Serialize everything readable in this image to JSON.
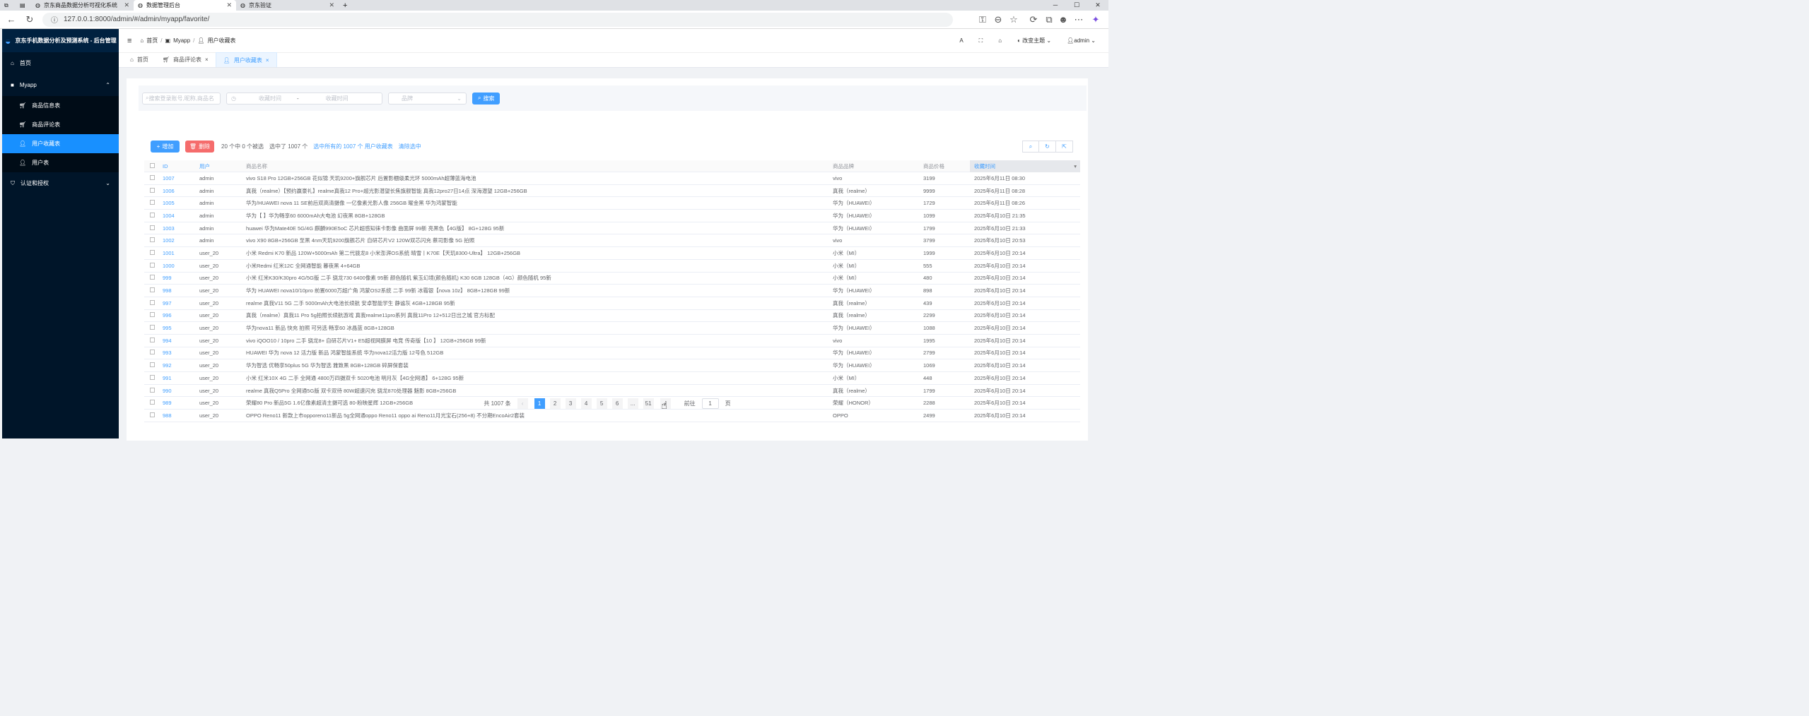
{
  "browser": {
    "tabs": [
      {
        "title": "京东商品数据分析可视化系统",
        "active": false
      },
      {
        "title": "数据管理后台",
        "active": true
      },
      {
        "title": "京东验证",
        "active": false
      }
    ],
    "url": "127.0.0.1:8000/admin/#/admin/myapp/favorite/"
  },
  "sidebar": {
    "brand": "京东手机数据分析及预测系统 - 后台管理",
    "items": [
      {
        "label": "首页",
        "icon": "home-icon",
        "level": 0
      },
      {
        "label": "Myapp",
        "icon": "square-icon",
        "level": 0,
        "expanded": true
      },
      {
        "label": "商品信息表",
        "icon": "cart-icon",
        "level": 1
      },
      {
        "label": "商品评论表",
        "icon": "cart-icon",
        "level": 1
      },
      {
        "label": "用户收藏表",
        "icon": "user-icon",
        "level": 1,
        "active": true
      },
      {
        "label": "用户表",
        "icon": "user-icon",
        "level": 1
      },
      {
        "label": "认证和授权",
        "icon": "shield-icon",
        "level": 0,
        "collapsible": true
      }
    ]
  },
  "header": {
    "breadcrumb": [
      "首页",
      "Myapp",
      "用户收藏表"
    ],
    "theme_label": "改变主题",
    "user_label": "admin"
  },
  "tabs": [
    {
      "label": "首页",
      "icon": "home-icon"
    },
    {
      "label": "商品评论表",
      "icon": "cart-icon",
      "closable": true
    },
    {
      "label": "用户收藏表",
      "icon": "user-icon",
      "closable": true,
      "active": true
    }
  ],
  "filters": {
    "search_placeholder": "搜索登录账号,昵称,商品名",
    "date_start_placeholder": "收藏时间",
    "date_sep": "-",
    "date_end_placeholder": "收藏时间",
    "brand_placeholder": "品牌",
    "search_button": "搜索"
  },
  "actions": {
    "add_label": "增加",
    "delete_label": "删除",
    "selection_text": "20 个中 0 个被选",
    "selected_count_text": "选中了 1007 个",
    "select_all_link": "选中所有的 1007 个 用户收藏表",
    "clear_link": "清除选中"
  },
  "table": {
    "columns": [
      "ID",
      "用户",
      "商品名称",
      "商品品牌",
      "商品价格",
      "收藏时间"
    ],
    "rows": [
      [
        "1007",
        "admin",
        "vivo S18 Pro 12GB+256GB 花似锦 天玑9200+旗舰芯片 后置影棚级柔光环 5000mAh超薄蓝海电池",
        "vivo",
        "3199",
        "2025年6月11日 08:30"
      ],
      [
        "1006",
        "admin",
        "真我（realme）【预约赢豪礼】realme真我12 Pro+超光影潜望长焦旗舰智能 真我12pro27日14点 深海潜望 12GB+256GB",
        "真我（realme）",
        "9999",
        "2025年6月11日 08:28"
      ],
      [
        "1005",
        "admin",
        "华为/HUAWEI nova 11 SE前后双高清摄像 一亿像素光影人像 256GB 曜金黑 华为鸿蒙智能",
        "华为（HUAWEI）",
        "1729",
        "2025年6月11日 08:26"
      ],
      [
        "1004",
        "admin",
        "华为【 】华为畅享60 6000mAh大电池 幻夜黑 8GB+128GB",
        "华为（HUAWEI）",
        "1099",
        "2025年6月10日 21:35"
      ],
      [
        "1003",
        "admin",
        "huawei 华为Mate40E 5G/4G 麒麟990E5oC 芯片超感知徕卡影像 曲面屏 99新 亮黑色【4G版】 8G+128G 95新",
        "华为（HUAWEI）",
        "1799",
        "2025年6月10日 21:33"
      ],
      [
        "1002",
        "admin",
        "vivo X90 8GB+256GB 至黑 4nm天玑9200旗舰芯片 自研芯片V2 120W双芯闪充 蔡司影像 5G 拍照",
        "vivo",
        "3799",
        "2025年6月10日 20:53"
      ],
      [
        "1001",
        "user_20",
        "小米 Redmi K70 新品 120W+5000mAh 第二代骁龙8 小米澎湃OS系统 晴雪丨K70E【天玑8300-Ultra】 12GB+256GB",
        "小米（MI）",
        "1999",
        "2025年6月10日 20:14"
      ],
      [
        "1000",
        "user_20",
        "小米Redmi 红米12C 全网通智能 暮夜黑 4+64GB",
        "小米（MI）",
        "555",
        "2025年6月10日 20:14"
      ],
      [
        "999",
        "user_20",
        "小米 红米K30/K30pro 4G/5G版 二手 骁龙730 6400像素 95新 颜色随机 紫玉幻境(颜色随机) K30 6GB 128GB（4G）颜色随机 95新",
        "小米（MI）",
        "480",
        "2025年6月10日 20:14"
      ],
      [
        "998",
        "user_20",
        "华为 HUAWEI nova10/10pro 前置6000万超广角 鸿蒙OS2系统 二手 99新 冰霜银【nova 10z】 8GB+128GB 99新",
        "华为（HUAWEI）",
        "898",
        "2025年6月10日 20:14"
      ],
      [
        "997",
        "user_20",
        "realme 真我V11 5G 二手 5000mAh大电池长续航 安卓智能学生 静谧灰 4GB+128GB 95新",
        "真我（realme）",
        "439",
        "2025年6月10日 20:14"
      ],
      [
        "996",
        "user_20",
        "真我（realme）真我11 Pro 5g拍照长续航游戏 真我realme11pro系列 真我11Pro 12+512日出之城 官方标配",
        "真我（realme）",
        "2299",
        "2025年6月10日 20:14"
      ],
      [
        "995",
        "user_20",
        "华为nova11 新品 快充 拍照 可另选 畅享60 冰晶蓝 8GB+128GB",
        "华为（HUAWEI）",
        "1088",
        "2025年6月10日 20:14"
      ],
      [
        "994",
        "user_20",
        "vivo iQOO10 / 10pro 二手 骁龙8+ 自研芯片V1+ E5超视网膜屏 电竞 传奇版【10 】 12GB+256GB 99新",
        "vivo",
        "1995",
        "2025年6月10日 20:14"
      ],
      [
        "993",
        "user_20",
        "HUAWEI 华为 nova 12 活力版 新品 鸿蒙智能系统 华为nova12活力版 12号色 512GB",
        "华为（HUAWEI）",
        "2799",
        "2025年6月10日 20:14"
      ],
      [
        "992",
        "user_20",
        "华为智选 优畅享50plus 5G 华为智选 雅致黑 8GB+128GB 碎屏保套装",
        "华为（HUAWEI）",
        "1069",
        "2025年6月10日 20:14"
      ],
      [
        "991",
        "user_20",
        "小米 红米10X 4G 二手 全网通 4800万四摄双卡 5020电池 明月灰【4G全网通】 6+128G 95新",
        "小米（MI）",
        "448",
        "2025年6月10日 20:14"
      ],
      [
        "990",
        "user_20",
        "realme 真我Q5Pro 全网通5G版 双卡双待 80W超速闪充 骁龙870处理器 魅影 8GB+256GB",
        "真我（realme）",
        "1799",
        "2025年6月10日 20:14"
      ],
      [
        "989",
        "user_20",
        "荣耀80 Pro 新品5G 1.6亿像素超清主摄可选 80-粉映星辉 12GB+256GB",
        "荣耀（HONOR）",
        "2288",
        "2025年6月10日 20:14"
      ],
      [
        "988",
        "user_20",
        "OPPO Reno11 新款上市opporeno11新品 5g全网通oppo Reno11 oppo ai Reno11月光宝石(256+8) 不分期EncoAir2套装",
        "OPPO",
        "2499",
        "2025年6月10日 20:14"
      ]
    ]
  },
  "pagination": {
    "total_text": "共 1007 条",
    "pages": [
      "1",
      "2",
      "3",
      "4",
      "5",
      "6",
      "...",
      "51"
    ],
    "current": "1",
    "goto_prefix": "前往",
    "goto_value": "1",
    "goto_suffix": "页"
  },
  "colors": {
    "sidebar_bg": "#001529",
    "primary": "#409eff",
    "danger": "#f56c6c"
  }
}
